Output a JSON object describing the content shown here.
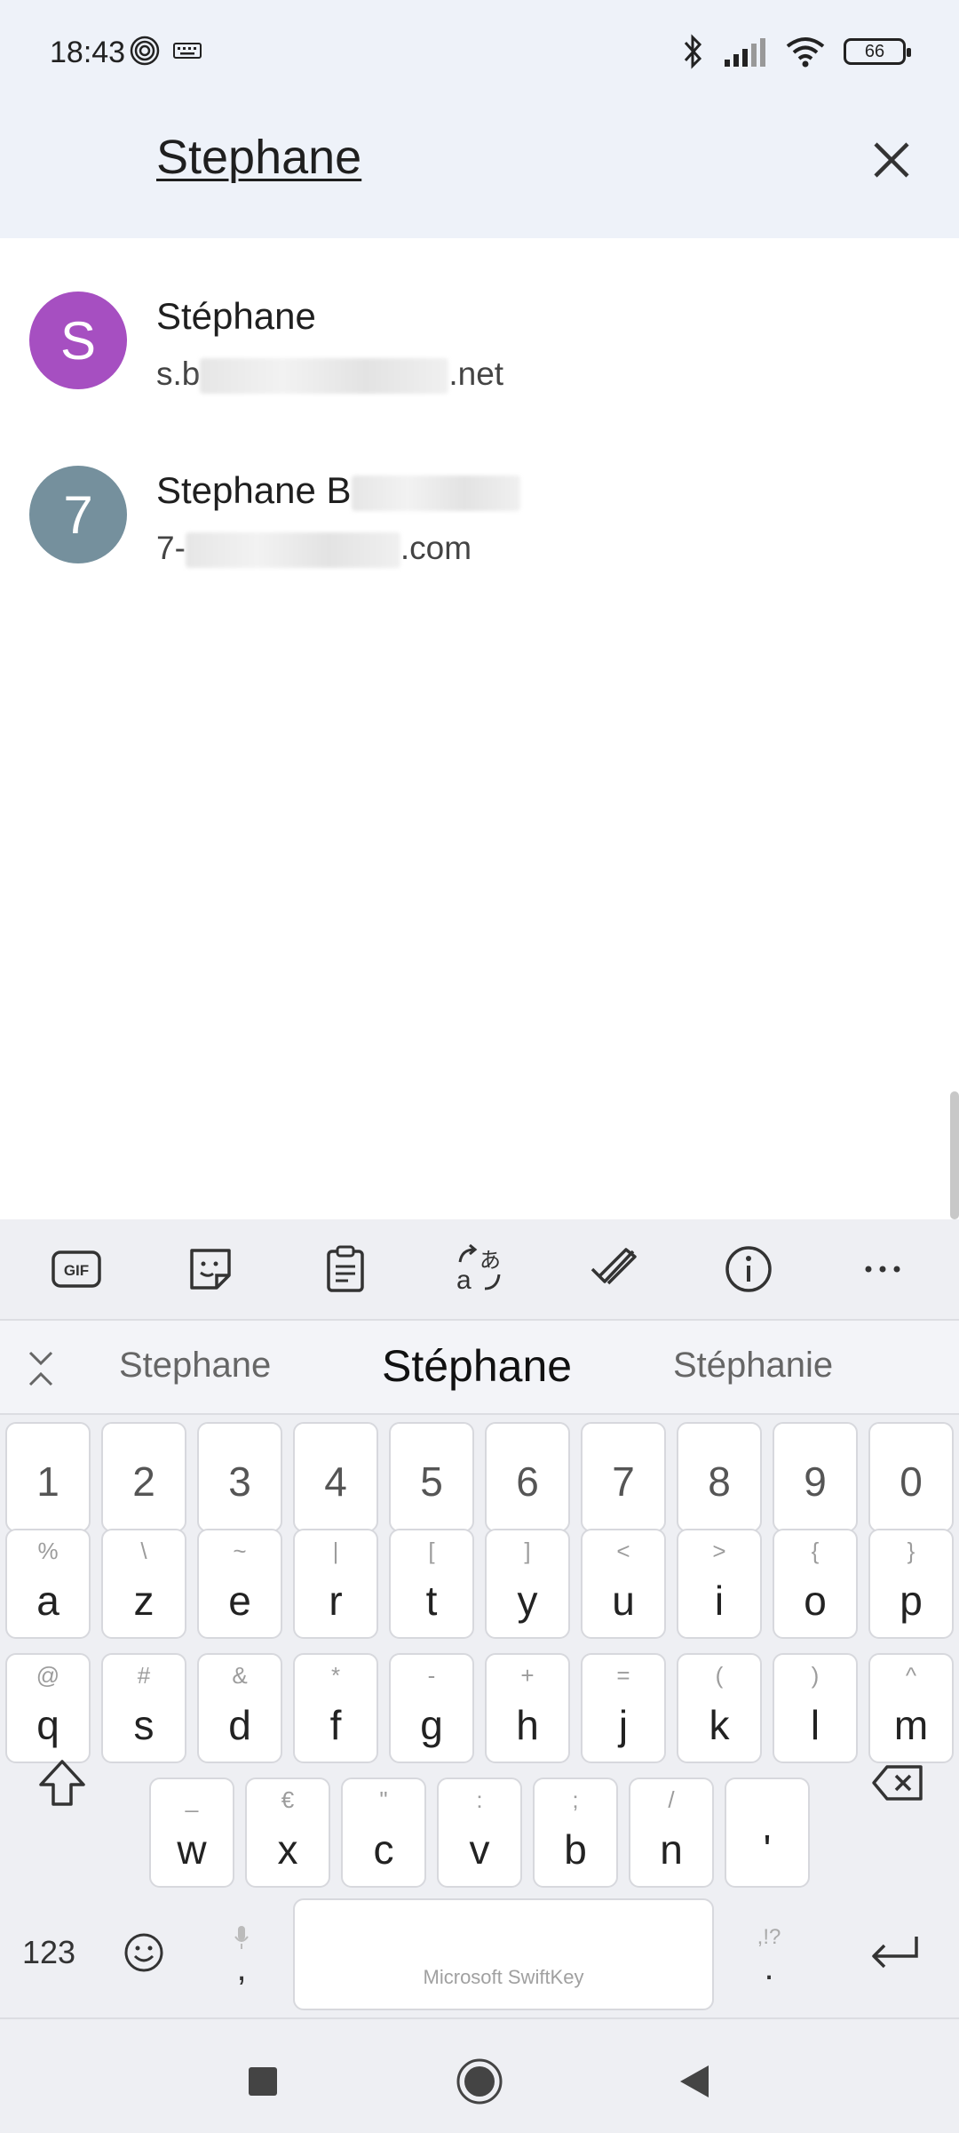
{
  "status": {
    "time": "18:43",
    "battery": "66"
  },
  "search": {
    "query": "Stephane"
  },
  "results": [
    {
      "initial": "S",
      "color": "#a64fc1",
      "name": "Stéphane",
      "email_start": "s.b",
      "email_end": ".net"
    },
    {
      "initial": "7",
      "color": "#75909d",
      "name": "Stephane B",
      "email_start": "7-",
      "email_end": ".com"
    }
  ],
  "keyboard": {
    "suggestions": [
      "Stephane",
      "Stéphane",
      "Stéphanie"
    ],
    "number_row": [
      "1",
      "2",
      "3",
      "4",
      "5",
      "6",
      "7",
      "8",
      "9",
      "0"
    ],
    "row1": [
      {
        "main": "a",
        "alt": "%"
      },
      {
        "main": "z",
        "alt": "\\"
      },
      {
        "main": "e",
        "alt": "~"
      },
      {
        "main": "r",
        "alt": "|"
      },
      {
        "main": "t",
        "alt": "["
      },
      {
        "main": "y",
        "alt": "]"
      },
      {
        "main": "u",
        "alt": "<"
      },
      {
        "main": "i",
        "alt": ">"
      },
      {
        "main": "o",
        "alt": "{"
      },
      {
        "main": "p",
        "alt": "}"
      }
    ],
    "row2": [
      {
        "main": "q",
        "alt": "@"
      },
      {
        "main": "s",
        "alt": "#"
      },
      {
        "main": "d",
        "alt": "&"
      },
      {
        "main": "f",
        "alt": "*"
      },
      {
        "main": "g",
        "alt": "-"
      },
      {
        "main": "h",
        "alt": "+"
      },
      {
        "main": "j",
        "alt": "="
      },
      {
        "main": "k",
        "alt": "("
      },
      {
        "main": "l",
        "alt": ")"
      },
      {
        "main": "m",
        "alt": "^"
      }
    ],
    "row3": [
      {
        "main": "w",
        "alt": "_"
      },
      {
        "main": "x",
        "alt": "€"
      },
      {
        "main": "c",
        "alt": "\""
      },
      {
        "main": "v",
        "alt": ":"
      },
      {
        "main": "b",
        "alt": ";"
      },
      {
        "main": "n",
        "alt": "/"
      },
      {
        "main": "'",
        "alt": ""
      }
    ],
    "numbers_key": "123",
    "comma_key": ",",
    "period_key": ".",
    "period_alt": ",!?",
    "space_label": "Microsoft SwiftKey"
  }
}
